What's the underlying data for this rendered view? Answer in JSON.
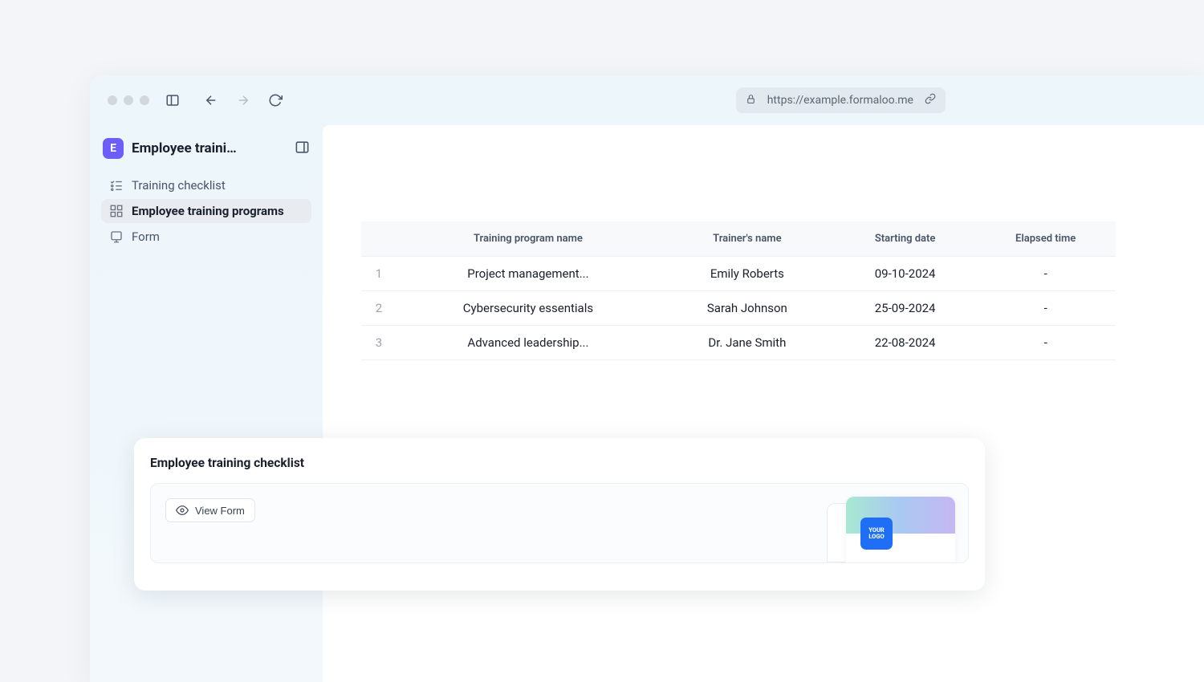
{
  "url": "https://example.formaloo.me",
  "app": {
    "logo_letter": "E",
    "title": "Employee traini…"
  },
  "sidebar": {
    "items": [
      {
        "label": "Training checklist"
      },
      {
        "label": "Employee training programs"
      },
      {
        "label": "Form"
      }
    ]
  },
  "table": {
    "headers": {
      "program": "Training program name",
      "trainer": "Trainer's name",
      "start": "Starting date",
      "elapsed": "Elapsed time"
    },
    "rows": [
      {
        "n": "1",
        "program": "Project management...",
        "trainer": "Emily Roberts",
        "start": "09-10-2024",
        "elapsed": "-"
      },
      {
        "n": "2",
        "program": "Cybersecurity essentials",
        "trainer": "Sarah Johnson",
        "start": "25-09-2024",
        "elapsed": "-"
      },
      {
        "n": "3",
        "program": "Advanced leadership...",
        "trainer": "Dr. Jane Smith",
        "start": "22-08-2024",
        "elapsed": "-"
      }
    ]
  },
  "card": {
    "title": "Employee training checklist",
    "view_form": "View Form",
    "logo_text": "YOUR LOGO"
  }
}
